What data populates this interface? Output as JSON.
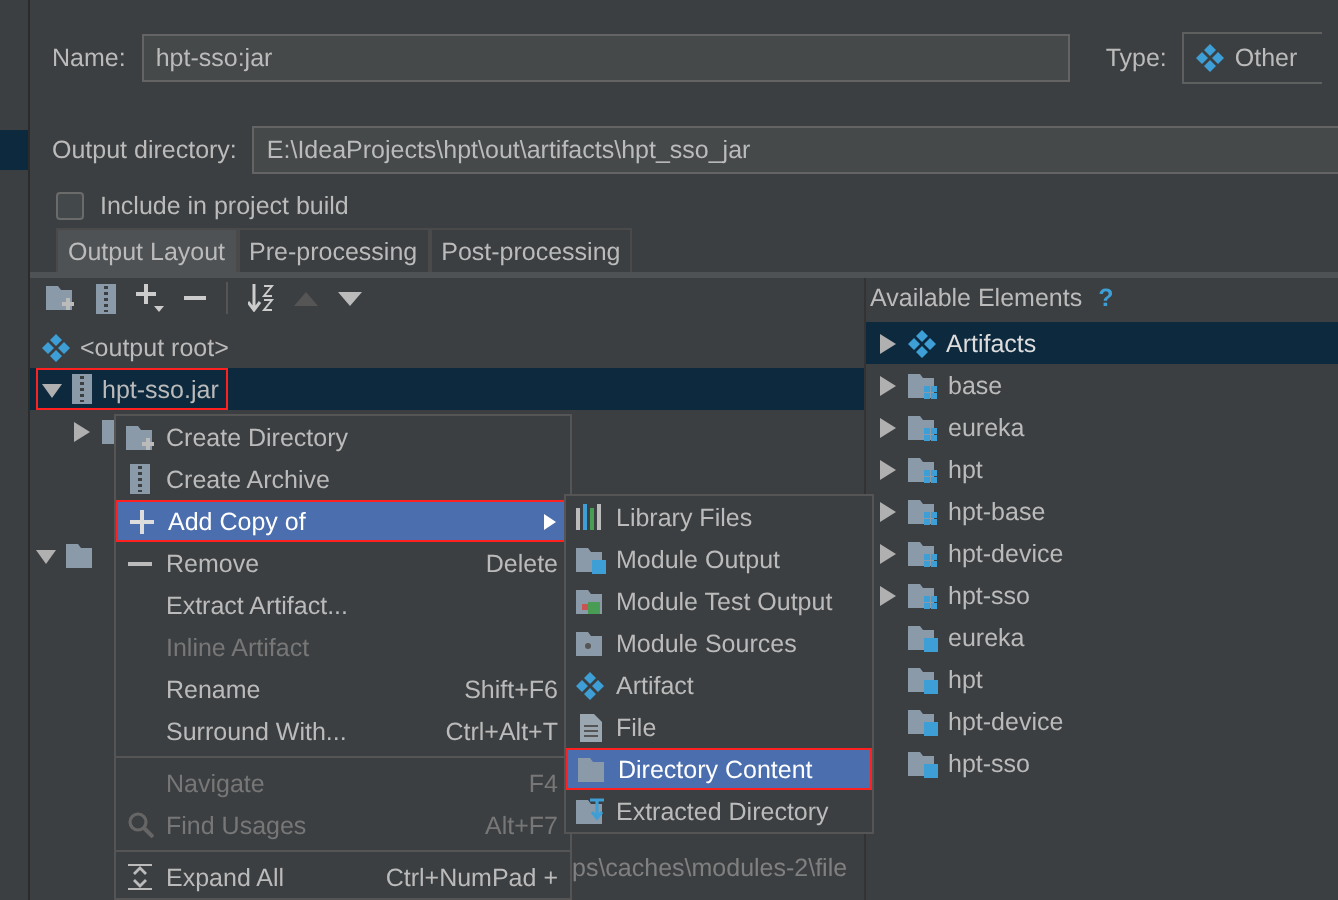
{
  "form": {
    "name_label": "Name:",
    "name_value": "hpt-sso:jar",
    "type_label": "Type:",
    "type_value": "Other",
    "output_label": "Output directory:",
    "output_value": "E:\\IdeaProjects\\hpt\\out\\artifacts\\hpt_sso_jar",
    "include_label": "Include in project build",
    "include_checked": false
  },
  "tabs": [
    {
      "label": "Output Layout",
      "selected": true
    },
    {
      "label": "Pre-processing",
      "selected": false
    },
    {
      "label": "Post-processing",
      "selected": false
    }
  ],
  "layout_tree": [
    {
      "label": "<output root>",
      "kind": "root",
      "selected": false,
      "annotated": false
    },
    {
      "label": "hpt-sso.jar",
      "kind": "archive",
      "selected": true,
      "annotated": true,
      "expanded": true,
      "children": [
        {
          "expanded": false
        },
        {
          "expanded": true
        }
      ]
    }
  ],
  "background_path": "ps\\caches\\modules-2\\file",
  "available": {
    "title": "Available Elements",
    "help": "?",
    "items": [
      {
        "label": "Artifacts",
        "kind": "artifact",
        "selected": true,
        "expandable": true
      },
      {
        "label": "base",
        "kind": "module",
        "selected": false,
        "expandable": true
      },
      {
        "label": "eureka",
        "kind": "module",
        "selected": false,
        "expandable": true
      },
      {
        "label": "hpt",
        "kind": "module",
        "selected": false,
        "expandable": true
      },
      {
        "label": "hpt-base",
        "kind": "module",
        "selected": false,
        "expandable": true
      },
      {
        "label": "hpt-device",
        "kind": "module",
        "selected": false,
        "expandable": true
      },
      {
        "label": "hpt-sso",
        "kind": "module",
        "selected": false,
        "expandable": true
      },
      {
        "label": "eureka",
        "kind": "output",
        "selected": false,
        "expandable": false
      },
      {
        "label": "hpt",
        "kind": "output",
        "selected": false,
        "expandable": false
      },
      {
        "label": "hpt-device",
        "kind": "output",
        "selected": false,
        "expandable": false
      },
      {
        "label": "hpt-sso",
        "kind": "output",
        "selected": false,
        "expandable": false
      }
    ]
  },
  "context_menu": [
    {
      "label": "Create Directory",
      "kind": "directory",
      "selected": false,
      "disabled": false,
      "annotated": false
    },
    {
      "label": "Create Archive",
      "kind": "archive",
      "selected": false,
      "disabled": false,
      "annotated": false
    },
    {
      "label": "Add Copy of",
      "kind": "add",
      "selected": true,
      "disabled": false,
      "annotated": true,
      "submenu": true
    },
    {
      "label": "Remove",
      "kind": "remove",
      "shortcut": "Delete",
      "selected": false,
      "disabled": false,
      "annotated": false
    },
    {
      "label": "Extract Artifact...",
      "kind": "plain",
      "selected": false,
      "disabled": false,
      "annotated": false
    },
    {
      "label": "Inline Artifact",
      "kind": "plain",
      "selected": false,
      "disabled": true,
      "annotated": false
    },
    {
      "label": "Rename",
      "kind": "plain",
      "shortcut": "Shift+F6",
      "selected": false,
      "disabled": false,
      "annotated": false
    },
    {
      "label": "Surround With...",
      "kind": "plain",
      "shortcut": "Ctrl+Alt+T",
      "selected": false,
      "disabled": false,
      "annotated": false,
      "separator_after": true
    },
    {
      "label": "Navigate",
      "kind": "plain",
      "shortcut": "F4",
      "selected": false,
      "disabled": true,
      "annotated": false
    },
    {
      "label": "Find Usages",
      "kind": "search",
      "shortcut": "Alt+F7",
      "selected": false,
      "disabled": true,
      "annotated": false,
      "separator_after": true
    },
    {
      "label": "Expand All",
      "kind": "expand",
      "shortcut": "Ctrl+NumPad +",
      "selected": false,
      "disabled": false,
      "annotated": false
    }
  ],
  "submenu": [
    {
      "label": "Library Files",
      "kind": "library",
      "selected": false,
      "annotated": false
    },
    {
      "label": "Module Output",
      "kind": "output",
      "selected": false,
      "annotated": false
    },
    {
      "label": "Module Test Output",
      "kind": "test",
      "selected": false,
      "annotated": false
    },
    {
      "label": "Module Sources",
      "kind": "sources",
      "selected": false,
      "annotated": false
    },
    {
      "label": "Artifact",
      "kind": "artifact",
      "selected": false,
      "annotated": false
    },
    {
      "label": "File",
      "kind": "file",
      "selected": false,
      "annotated": false
    },
    {
      "label": "Directory Content",
      "kind": "content",
      "selected": true,
      "annotated": true
    },
    {
      "label": "Extracted Directory",
      "kind": "extracted",
      "selected": false,
      "annotated": false
    }
  ]
}
